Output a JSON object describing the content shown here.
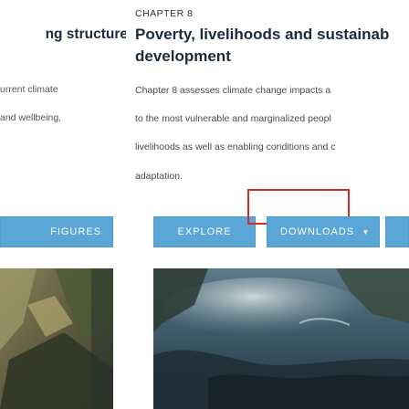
{
  "left_card": {
    "title": "ng structure",
    "body_lines": [
      "urrent climate",
      "and wellbeing,"
    ],
    "button_label": "FIGURES"
  },
  "right_card": {
    "kicker": "CHAPTER 8",
    "title_lines": [
      "Poverty, livelihoods and sustainab",
      "development"
    ],
    "body_lines": [
      "Chapter 8 assesses climate change impacts a",
      "to the most vulnerable and marginalized peopl",
      "livelihoods as well as enabling conditions and c",
      "adaptation."
    ],
    "buttons": {
      "explore": "EXPLORE",
      "downloads": "DOWNLOADS",
      "downloads_caret": "▾"
    }
  },
  "colors": {
    "button_bg": "#5aa6d6",
    "focus_outline": "#d72a2a",
    "title_text": "#1b2b3c"
  }
}
